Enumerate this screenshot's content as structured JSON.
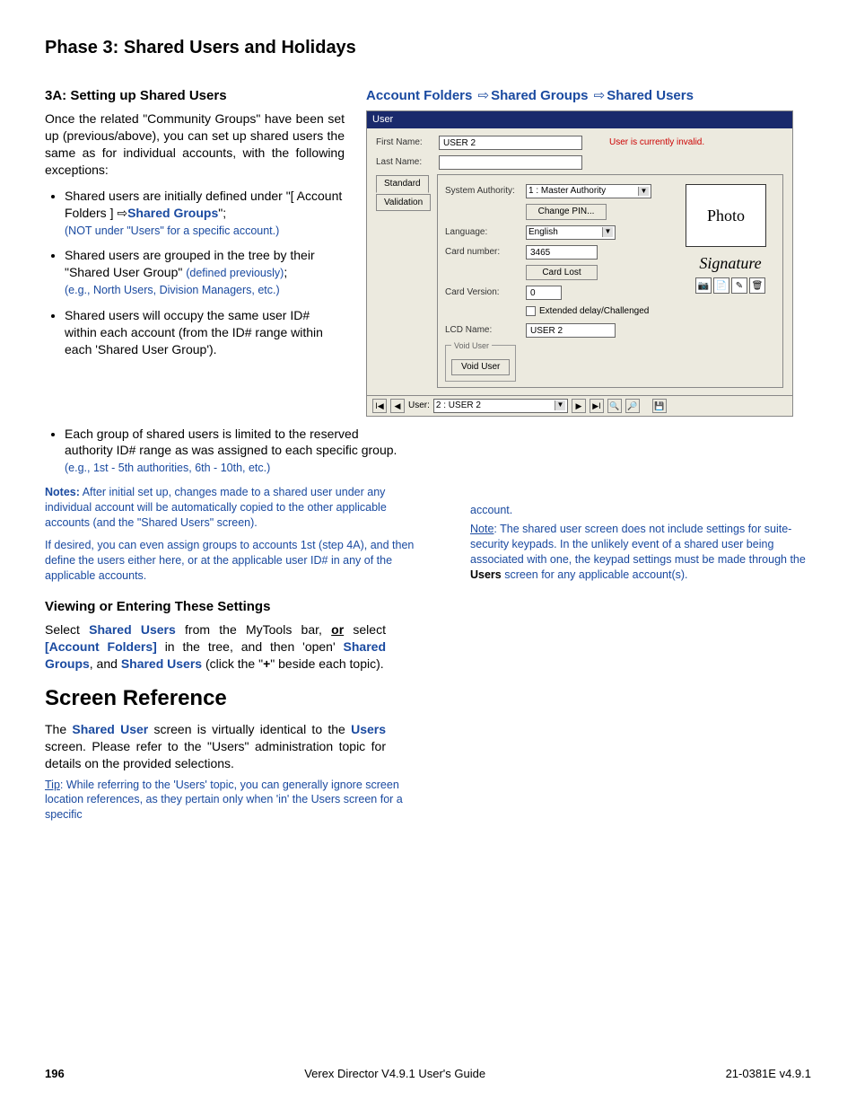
{
  "headings": {
    "phase": "Phase 3:  Shared Users and Holidays",
    "sub_3a": "3A:  Setting up Shared Users",
    "viewing": "Viewing or Entering These Settings",
    "screenref": "Screen Reference"
  },
  "breadcrumb": {
    "a": "Account Folders",
    "b": "Shared Groups",
    "c": "Shared Users"
  },
  "body": {
    "p1": "Once the related \"Community Groups\" have been set up (previous/above), you can set up shared users the same as for individual accounts, with the following exceptions:",
    "b1a": "Shared users are initially defined under \"[ Account Folders ]  ",
    "b1b_link": "Shared Groups",
    "b1c": "\";",
    "b1_note": "(NOT under \"Users\" for a specific account.)",
    "b2a": "Shared users are grouped in the tree by their \"Shared User Group\" ",
    "b2b": "(defined previously)",
    "b2c": ";",
    "b2_note": "(e.g., North Users,  Division Managers, etc.)",
    "b3": "Shared users will occupy the same user ID# within each account (from the ID# range within each 'Shared User Group').",
    "b4a": "Each group of shared users is limited to the reserved authority ID# range as was assigned to each specific group.",
    "b4_note": "(e.g., 1st - 5th authorities,  6th - 10th, etc.)",
    "notes_label": "Notes:",
    "notes1": "  After initial set up, changes made to a shared user under any individual account will be automatically copied to the other applicable accounts (and the \"Shared Users\" screen).",
    "notes2": "If desired, you can even assign groups to accounts 1st (step 4A), and then define the users either here, or at the applicable user ID# in any of the applicable accounts.",
    "view_p1a": "Select ",
    "view_p1b": "Shared Users",
    "view_p1c": " from the MyTools bar, ",
    "view_p1d": "or",
    "view_p1e": " select ",
    "view_p1f": "[Account Folders]",
    "view_p1g": " in the tree, and then 'open' ",
    "view_p1h": "Shared Groups",
    "view_p1i": ", and ",
    "view_p1j": "Shared Users",
    "view_p1k": " (click the \"",
    "view_p1l": "+",
    "view_p1m": "\" beside each topic).",
    "sr_p1a": "The ",
    "sr_p1b": "Shared User",
    "sr_p1c": " screen is virtually identical to the ",
    "sr_p1d": "Users",
    "sr_p1e": " screen.  Please refer to the \"Users\" administration topic for details on the provided selections.",
    "tip_label": "Tip",
    "tip": ":  While referring to the 'Users' topic, you can generally ignore screen location references, as they pertain only when 'in' the Users screen for a specific ",
    "tip2": "account.",
    "note_label": "Note",
    "note_right": ":  The shared user screen does not include settings for suite-security keypads.  In the unlikely event of a shared user being associated with one, the keypad settings must be made through the ",
    "users_bold": "Users",
    "note_right2": " screen for any applicable account(s)."
  },
  "screenshot": {
    "title": "User",
    "first_name_label": "First Name:",
    "first_name_value": "USER 2",
    "last_name_label": "Last Name:",
    "status": "User is currently invalid.",
    "tab_standard": "Standard",
    "tab_validation": "Validation",
    "sys_authority_label": "System Authority:",
    "sys_authority_value": "1 : Master Authority",
    "change_pin": "Change PIN...",
    "language_label": "Language:",
    "language_value": "English",
    "card_number_label": "Card number:",
    "card_number_value": "3465",
    "card_lost": "Card Lost",
    "card_version_label": "Card Version:",
    "card_version_value": "0",
    "extended_label": "Extended delay/Challenged",
    "lcd_name_label": "LCD Name:",
    "lcd_name_value": "USER 2",
    "void_user_group": "Void User",
    "void_user_btn": "Void User",
    "photo": "Photo",
    "signature": "Signature",
    "footer_user_label": "User:",
    "footer_user_value": "2 : USER 2"
  },
  "footer": {
    "page": "196",
    "center": "Verex Director V4.9.1 User's Guide",
    "right": "21-0381E v4.9.1"
  }
}
